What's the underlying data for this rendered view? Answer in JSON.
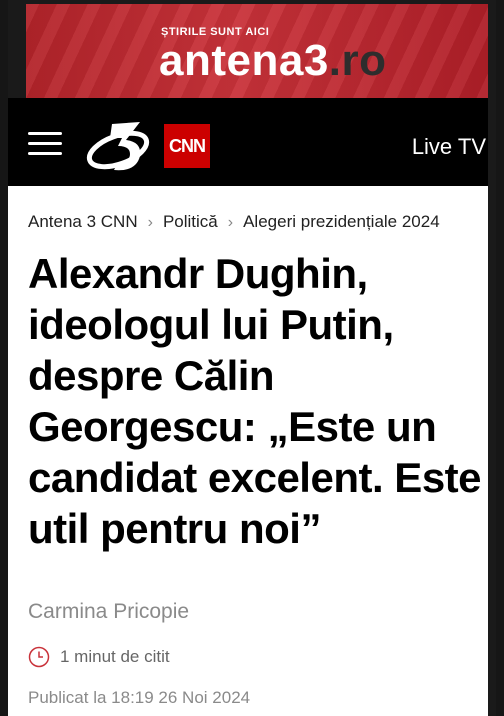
{
  "banner": {
    "tagline": "ȘTIRILE SUNT AICI",
    "site_name": "antena3",
    "site_tld": ".ro"
  },
  "navbar": {
    "menu_icon": "hamburger-menu-icon",
    "logo_icon": "antena3-logo",
    "cnn_label": "CNN",
    "live_tv": "Live TV"
  },
  "breadcrumb": {
    "items": [
      "Antena 3 CNN",
      "Politică",
      "Alegeri prezidențiale 2024"
    ],
    "separator": "›"
  },
  "article": {
    "headline": "Alexandr Dughin, ideologul lui Putin, despre Călin Georgescu: „Este un candidat excelent. Este util pentru noi”",
    "author": "Carmina Pricopie",
    "read_time": "1 minut de citit",
    "published": "Publicat la 18:19 26 Noi 2024"
  },
  "colors": {
    "brand_red": "#c9323a",
    "cnn_red": "#cc0000",
    "nav_bg": "#000000"
  }
}
